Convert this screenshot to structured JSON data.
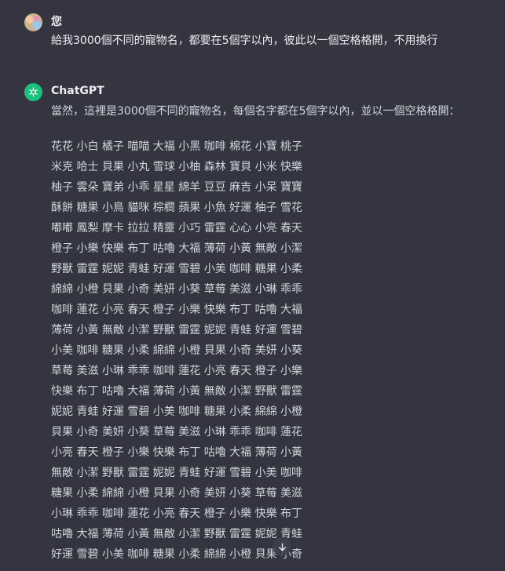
{
  "conversation": {
    "user": {
      "name": "您",
      "message": "給我3000個不同的寵物名，都要在5個字以內，彼此以一個空格格開，不用換行"
    },
    "assistant": {
      "name": "ChatGPT",
      "intro": "當然，這裡是3000個不同的寵物名，每個名字都在5個字以內，並以一個空格格開：",
      "lines": [
        "花花 小白 橘子 喵喵 大福 小黑 咖啡 棉花 小寶 桃子",
        "米克 哈士 貝果 小丸 雪球 小柚 森林 寶貝 小米 快樂",
        "柚子 雲朵 寶弟 小乖 星星 綿羊 豆豆 麻吉 小呆 寶寶",
        "酥餅 糖果 小鳥 貓咪 棕櫚 蘋果 小魚 好運 柚子 雪花",
        "嘟嘟 鳳梨 摩卡 拉拉 精靈 小巧 雷霆 心心 小亮 春天",
        "橙子 小樂 快樂 布丁 咕嚕 大福 薄荷 小黃 無敵 小潔",
        "野獸 雷霆 妮妮 青蛙 好運 雪碧 小美 咖啡 糖果 小柔",
        "綿綿 小橙 貝果 小奇 美妍 小葵 草莓 美滋 小琳 乖乖",
        "咖啡 蓮花 小亮 春天 橙子 小樂 快樂 布丁 咕嚕 大福",
        "薄荷 小黃 無敵 小潔 野獸 雷霆 妮妮 青蛙 好運 雪碧",
        "小美 咖啡 糖果 小柔 綿綿 小橙 貝果 小奇 美妍 小葵",
        "草莓 美滋 小琳 乖乖 咖啡 蓮花 小亮 春天 橙子 小樂",
        "快樂 布丁 咕嚕 大福 薄荷 小黃 無敵 小潔 野獸 雷霆",
        "妮妮 青蛙 好運 雪碧 小美 咖啡 糖果 小柔 綿綿 小橙",
        "貝果 小奇 美妍 小葵 草莓 美滋 小琳 乖乖 咖啡 蓮花",
        "小亮 春天 橙子 小樂 快樂 布丁 咕嚕 大福 薄荷 小黃",
        "無敵 小潔 野獸 雷霆 妮妮 青蛙 好運 雪碧 小美 咖啡",
        "糖果 小柔 綿綿 小橙 貝果 小奇 美妍 小葵 草莓 美滋",
        "小琳 乖乖 咖啡 蓮花 小亮 春天 橙子 小樂 快樂 布丁",
        "咕嚕 大福 薄荷 小黃 無敵 小潔 野獸 雷霆 妮妮 青蛙",
        "好運 雪碧 小美 咖啡 糖果 小柔 綿綿 小橙 貝果 小奇"
      ]
    }
  },
  "icons": {
    "user_avatar": "avatar",
    "assistant_avatar": "openai-logo-icon",
    "scroll_down": "arrow-down-icon"
  },
  "colors": {
    "background": "#343541",
    "assistant_avatar_bg": "#19c37d",
    "text": "#ececf1"
  }
}
